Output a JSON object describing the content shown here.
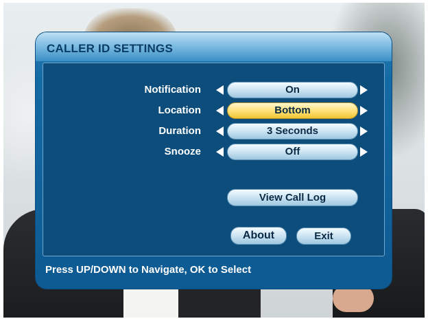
{
  "dialog": {
    "title": "CALLER ID SETTINGS",
    "footer": "Press UP/DOWN to Navigate, OK to Select"
  },
  "settings": [
    {
      "label": "Notification",
      "value": "On",
      "selected": false
    },
    {
      "label": "Location",
      "value": "Bottom",
      "selected": true
    },
    {
      "label": "Duration",
      "value": "3 Seconds",
      "selected": false
    },
    {
      "label": "Snooze",
      "value": "Off",
      "selected": false
    }
  ],
  "buttons": {
    "view_call_log": "View Call Log",
    "about": "About",
    "exit": "Exit"
  },
  "colors": {
    "panel": "#146aa5",
    "selected_highlight": "#ffe27a",
    "title_text": "#0a3d66"
  },
  "icons": {
    "left_arrow": "triangle-left",
    "right_arrow": "triangle-right"
  }
}
